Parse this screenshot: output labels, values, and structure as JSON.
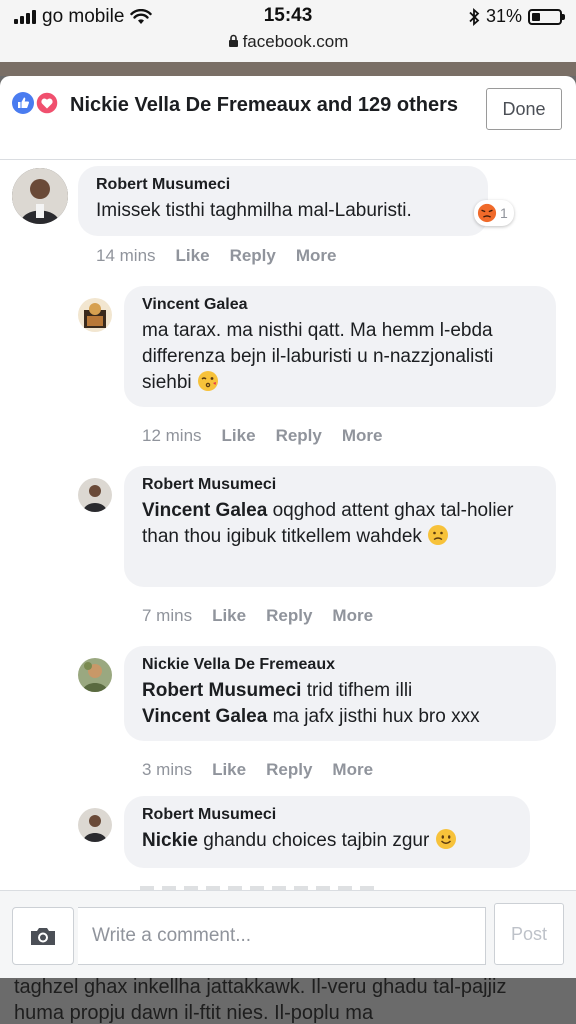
{
  "status_bar": {
    "carrier": "go mobile",
    "time": "15:43",
    "battery": "31%",
    "battery_level": 0.31,
    "url": "facebook.com"
  },
  "header": {
    "reactions_text": "Nickie Vella De Fremeaux and 129 others",
    "reaction_icons": [
      "like-icon",
      "love-icon"
    ],
    "done_label": "Done"
  },
  "comments": [
    {
      "name": "Robert Musumeci",
      "text": "Imissek tisthi taghmilha mal-Laburisti.",
      "emoji": "angry-emoji",
      "reaction_count": "1",
      "time": "14 mins",
      "like": "Like",
      "reply": "Reply",
      "more": "More"
    },
    {
      "name": "Vincent Galea",
      "text": "ma tarax. ma nisthi qatt. Ma hemm l-ebda differenza bejn il-laburisti u n-nazzjonalisti siehbi",
      "emoji": "kissing-wink-emoji",
      "time": "12 mins",
      "like": "Like",
      "reply": "Reply",
      "more": "More"
    },
    {
      "name": "Robert Musumeci",
      "mention": "Vincent Galea",
      "text": " oqghod attent ghax tal-holier than thou igibuk titkellem wahdek",
      "emoji": "worried-emoji",
      "time": "7 mins",
      "like": "Like",
      "reply": "Reply",
      "more": "More"
    },
    {
      "name": "Nickie Vella De Fremeaux",
      "mention": "Robert Musumeci",
      "text": " trid tifhem illi",
      "mention2": "Vincent Galea",
      "text2": " ma jafx jisthi hux bro xxx",
      "time": "3 mins",
      "like": "Like",
      "reply": "Reply",
      "more": "More"
    },
    {
      "name": "Robert Musumeci",
      "mention": "Nickie",
      "text": " ghandu choices tajbin zgur",
      "emoji": "smile-emoji"
    }
  ],
  "compose": {
    "camera_icon": "camera-icon",
    "placeholder": "Write a comment...",
    "post_label": "Post"
  },
  "background_text": "taghzel ghax inkellha jattakkawk. Il-veru ghadu tal-pajjiz huma propju dawn il-ftit nies. Il-poplu ma"
}
